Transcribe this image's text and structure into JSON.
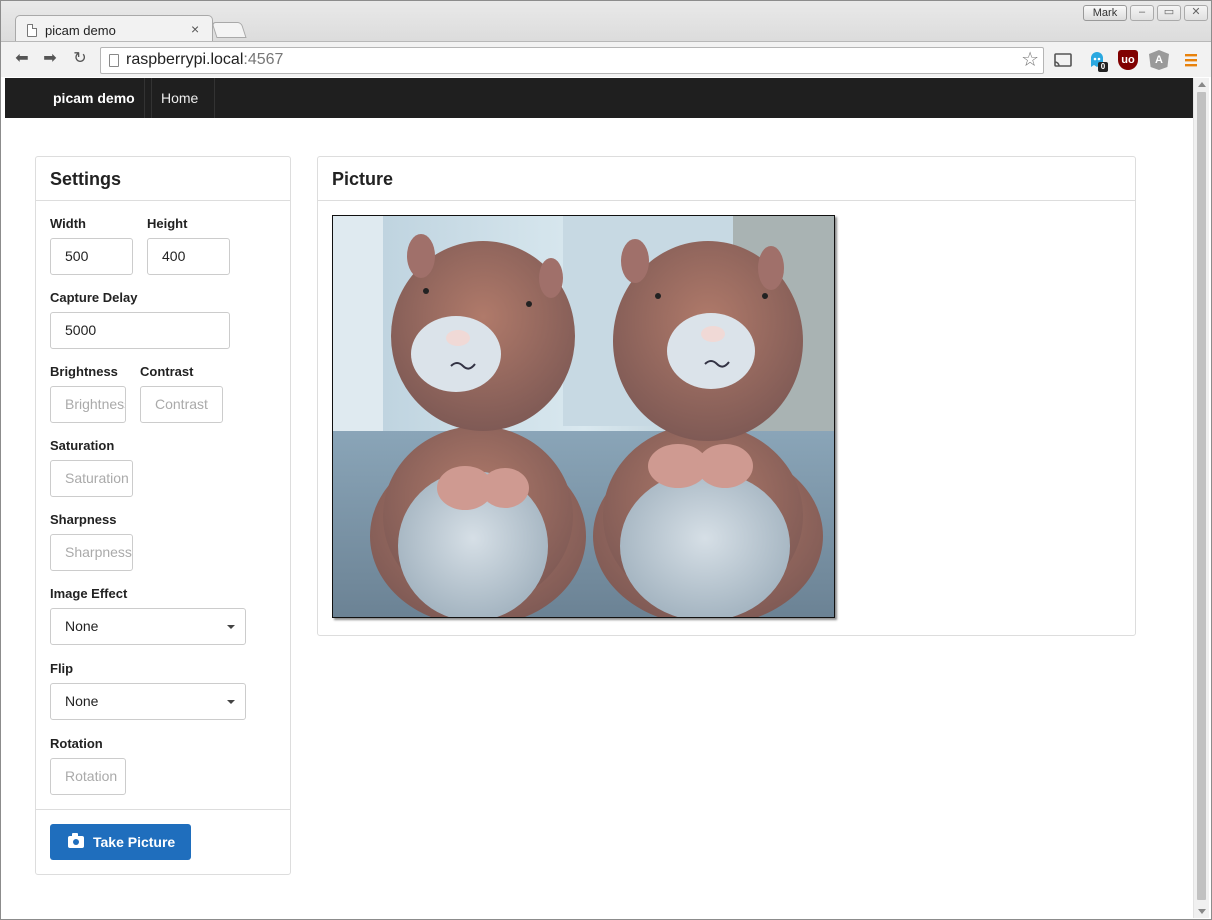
{
  "browser": {
    "tab_title": "picam demo",
    "tab_close": "×",
    "profile_name": "Mark",
    "window_buttons": [
      "–",
      "▭",
      "✕"
    ],
    "url_host": "raspberrypi.local",
    "url_port": ":4567",
    "extensions": [
      {
        "name": "cast-icon",
        "badge": ""
      },
      {
        "name": "ghostery-icon",
        "badge": "0"
      },
      {
        "name": "ublock-icon",
        "badge": "uo"
      },
      {
        "name": "angular-icon",
        "badge": "A"
      },
      {
        "name": "menu-icon",
        "badge": ""
      }
    ]
  },
  "navbar": {
    "brand": "picam demo",
    "home": "Home"
  },
  "settings": {
    "title": "Settings",
    "width_label": "Width",
    "width_value": "500",
    "height_label": "Height",
    "height_value": "400",
    "capture_delay_label": "Capture Delay",
    "capture_delay_value": "5000",
    "brightness_label": "Brightness",
    "brightness_placeholder": "Brightness",
    "contrast_label": "Contrast",
    "contrast_placeholder": "Contrast",
    "saturation_label": "Saturation",
    "saturation_placeholder": "Saturation",
    "sharpness_label": "Sharpness",
    "sharpness_placeholder": "Sharpness",
    "image_effect_label": "Image Effect",
    "image_effect_value": "None",
    "flip_label": "Flip",
    "flip_value": "None",
    "rotation_label": "Rotation",
    "rotation_placeholder": "Rotation",
    "take_picture": "Take Picture"
  },
  "picture": {
    "title": "Picture"
  },
  "colors": {
    "navbar": "#1f1f1f",
    "primary_button": "#1f6ebd"
  }
}
